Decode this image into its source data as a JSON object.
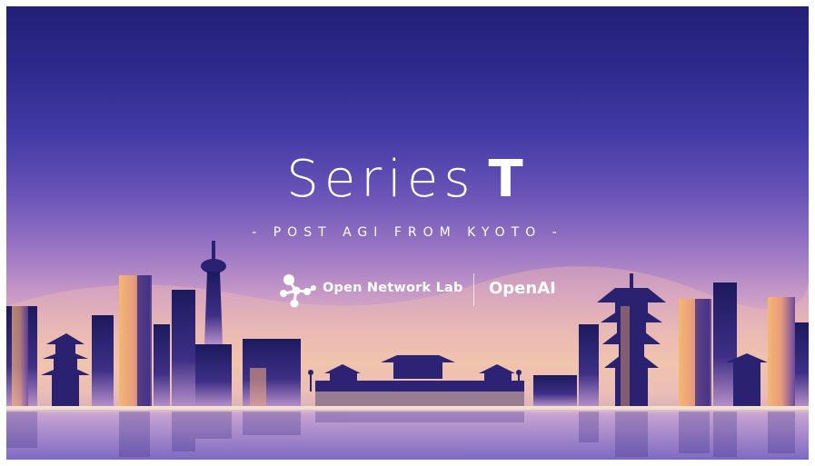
{
  "title": {
    "light": "Series",
    "bold": "T"
  },
  "subtitle": "- POST AGI FROM KYOTO -",
  "logos": {
    "open_network_lab": "Open Network Lab",
    "openai": "OpenAI"
  },
  "colors": {
    "sky_top": "#221f77",
    "sky_mid": "#9b77c4",
    "horizon": "#f1c6ad",
    "water": "#8b78c6",
    "text": "#ffffff"
  },
  "icons": [
    "open-network-lab-logo-icon"
  ]
}
